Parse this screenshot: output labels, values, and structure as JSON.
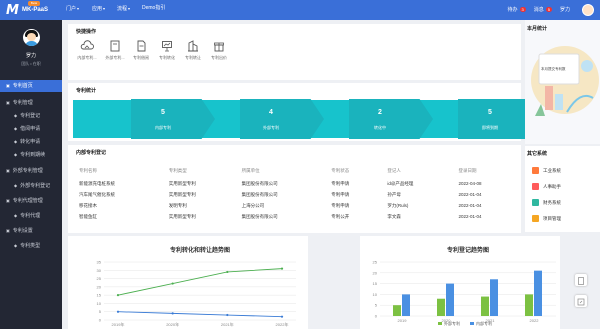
{
  "topbar": {
    "logo_sub": "Beta",
    "logo_text": "MK-PaaS",
    "nav": [
      "门户",
      "应用",
      "流程",
      "Demo指引"
    ],
    "todo": "待办",
    "todo_count": "3",
    "message": "消息",
    "message_count": "5",
    "user": "罗力"
  },
  "sidebar": {
    "user_name": "罗力",
    "user_status": "团队 • 在职",
    "items": [
      {
        "label": "专利首页",
        "active": true,
        "sub": false
      },
      {
        "label": "专利管理",
        "active": false,
        "sub": false
      },
      {
        "label": "专利登记",
        "active": false,
        "sub": true
      },
      {
        "label": "借阅申请",
        "active": false,
        "sub": true
      },
      {
        "label": "转化申请",
        "active": false,
        "sub": true
      },
      {
        "label": "专利到期续",
        "active": false,
        "sub": true
      },
      {
        "label": "外部专利管理",
        "active": false,
        "sub": false
      },
      {
        "label": "外部专利登记",
        "active": false,
        "sub": true
      },
      {
        "label": "专利代理管理",
        "active": false,
        "sub": false
      },
      {
        "label": "专利代理",
        "active": false,
        "sub": true
      },
      {
        "label": "专利设置",
        "active": false,
        "sub": false
      },
      {
        "label": "专利类型",
        "active": false,
        "sub": true
      }
    ]
  },
  "quick": {
    "title": "快捷操作",
    "items": [
      "内部专利...",
      "外部专利...",
      "专利借阅",
      "专利转化",
      "专利转让",
      "专利出价"
    ]
  },
  "stats": {
    "title": "专利统计",
    "items": [
      {
        "value": "5",
        "label": "内部专利"
      },
      {
        "value": "4",
        "label": "外部专利"
      },
      {
        "value": "2",
        "label": "转化中"
      },
      {
        "value": "5",
        "label": "即将到期"
      }
    ]
  },
  "monthly": {
    "title": "本月统计",
    "banner": "本月提交专利数"
  },
  "table": {
    "title": "内部专利登记",
    "columns": [
      "专利名称",
      "专利类型",
      "所属单位",
      "专利状态",
      "登记人",
      "登录日期"
    ],
    "rows": [
      [
        "新能源充电桩系统",
        "实用新型专利",
        "集团股份有限公司",
        "专利申请",
        "id@产品经理",
        "2022-04-08"
      ],
      [
        "汽车尾气催化系统",
        "实用新型专利",
        "集团股份有限公司",
        "专利申请",
        "孙产母",
        "2022-01-04"
      ],
      [
        "移花接木",
        "发明专利",
        "上海分公司",
        "专利申请",
        "罗力(Ruls)",
        "2022-01-04"
      ],
      [
        "智能鱼缸",
        "实用新型专利",
        "集团股份有限公司",
        "专利公开",
        "李文森",
        "2022-01-04"
      ]
    ]
  },
  "systems": {
    "title": "其它系统",
    "items": [
      {
        "label": "工业系统",
        "color": "#ff7a3c"
      },
      {
        "label": "人事助手",
        "color": "#ff5b5b"
      },
      {
        "label": "财务系统",
        "color": "#2fb8a0"
      },
      {
        "label": "项目管理",
        "color": "#f5a623"
      }
    ]
  },
  "chart_data": [
    {
      "type": "line",
      "title": "专利转化和转让趋势图",
      "categories": [
        "2019年",
        "2020年",
        "2021年",
        "2022年"
      ],
      "ylim": [
        0,
        35
      ],
      "yticks": [
        0,
        5,
        10,
        15,
        20,
        25,
        30,
        35
      ],
      "series": [
        {
          "name": "专利转化",
          "color": "#4caf50",
          "values": [
            15,
            22,
            29,
            31
          ]
        },
        {
          "name": "专利转让",
          "color": "#3a7bd5",
          "values": [
            5,
            4,
            3,
            2
          ]
        }
      ]
    },
    {
      "type": "bar",
      "title": "专利登记趋势图",
      "categories": [
        "2019",
        "2020",
        "2021",
        "2022"
      ],
      "ylim": [
        0,
        25
      ],
      "yticks": [
        0,
        5,
        10,
        15,
        20,
        25
      ],
      "series": [
        {
          "name": "外部专利",
          "color": "#7cc142",
          "values": [
            5,
            8,
            9,
            10
          ]
        },
        {
          "name": "内部专利",
          "color": "#4a90e2",
          "values": [
            10,
            15,
            17,
            21
          ]
        }
      ]
    }
  ]
}
